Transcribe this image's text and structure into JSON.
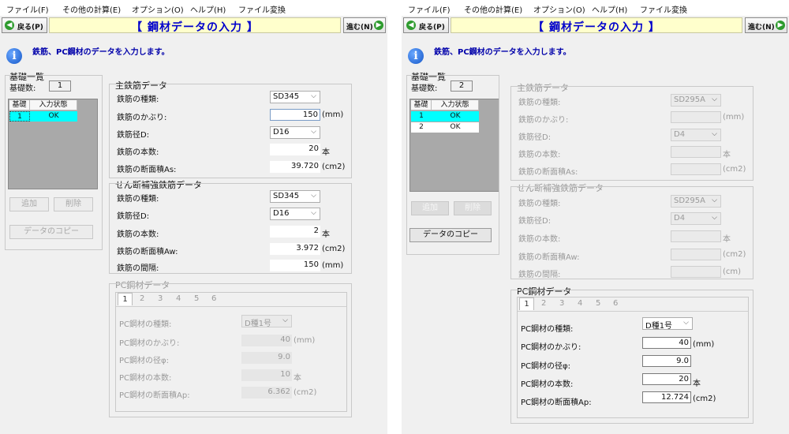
{
  "menu": [
    "ファイル(F)",
    "その他の計算(E)",
    "オプション(O)",
    "ヘルプ(H)",
    "ファイル変換"
  ],
  "nav": {
    "back": "戻る(P)",
    "next": "進む(N)",
    "title": "【 鋼材データの入力 】"
  },
  "info": "鉄筋、PC鋼材のデータを入力します。",
  "foundation": {
    "group_title": "基礎一覧",
    "count_label": "基礎数:",
    "col_foundation": "基礎",
    "col_status": "入力状態",
    "add_label": "追加",
    "delete_label": "削除",
    "copy_label": "データのコピー"
  },
  "main_rebar": {
    "title": "主鉄筋データ",
    "type_label": "鉄筋の種類:",
    "cover_label": "鉄筋のかぶり:",
    "diameter_label": "鉄筋径D:",
    "count_label": "鉄筋の本数:",
    "area_label": "鉄筋の断面積As:"
  },
  "shear_rebar": {
    "title": "せん断補強鉄筋データ",
    "type_label": "鉄筋の種類:",
    "diameter_label": "鉄筋径D:",
    "count_label": "鉄筋の本数:",
    "area_label": "鉄筋の断面積Aw:",
    "spacing_label": "鉄筋の間隔:"
  },
  "pc": {
    "title": "PC鋼材データ",
    "tabs": [
      "1",
      "2",
      "3",
      "4",
      "5",
      "6"
    ],
    "type_label": "PC鋼材の種類:",
    "cover_label": "PC鋼材のかぶり:",
    "diameter_label": "PC鋼材の径φ:",
    "count_label": "PC鋼材の本数:",
    "area_label": "PC鋼材の断面積Ap:"
  },
  "units": {
    "mm": "(mm)",
    "cm2": "(cm2)",
    "cm": "(cm)",
    "hon": "本"
  },
  "left": {
    "count": "1",
    "rows": [
      {
        "no": "1",
        "status": "OK"
      }
    ],
    "main_type": "SD345",
    "main_cover": "150",
    "main_dia": "D16",
    "main_count": "20",
    "main_area": "39.720",
    "shear_type": "SD345",
    "shear_dia": "D16",
    "shear_count": "2",
    "shear_area": "3.972",
    "shear_spacing": "150",
    "pc_type": "D種1号",
    "pc_cover": "40",
    "pc_dia": "9.0",
    "pc_count": "10",
    "pc_area": "6.362"
  },
  "right": {
    "count": "2",
    "rows": [
      {
        "no": "1",
        "status": "OK"
      },
      {
        "no": "2",
        "status": "OK"
      }
    ],
    "main_type": "SD295A",
    "main_dia": "D4",
    "shear_type": "SD295A",
    "shear_dia": "D4",
    "pc_type": "D種1号",
    "pc_cover": "40",
    "pc_dia": "9.0",
    "pc_count": "20",
    "pc_area": "12.724"
  },
  "colors": {
    "title_bg": "#ffffcc",
    "title_text": "#0000cc",
    "selected_row": "#00ffff",
    "list_bg": "#a9a9a9"
  },
  "icons": [
    "back-arrow-icon",
    "next-arrow-icon",
    "info-icon",
    "dropdown-arrow-icon"
  ]
}
